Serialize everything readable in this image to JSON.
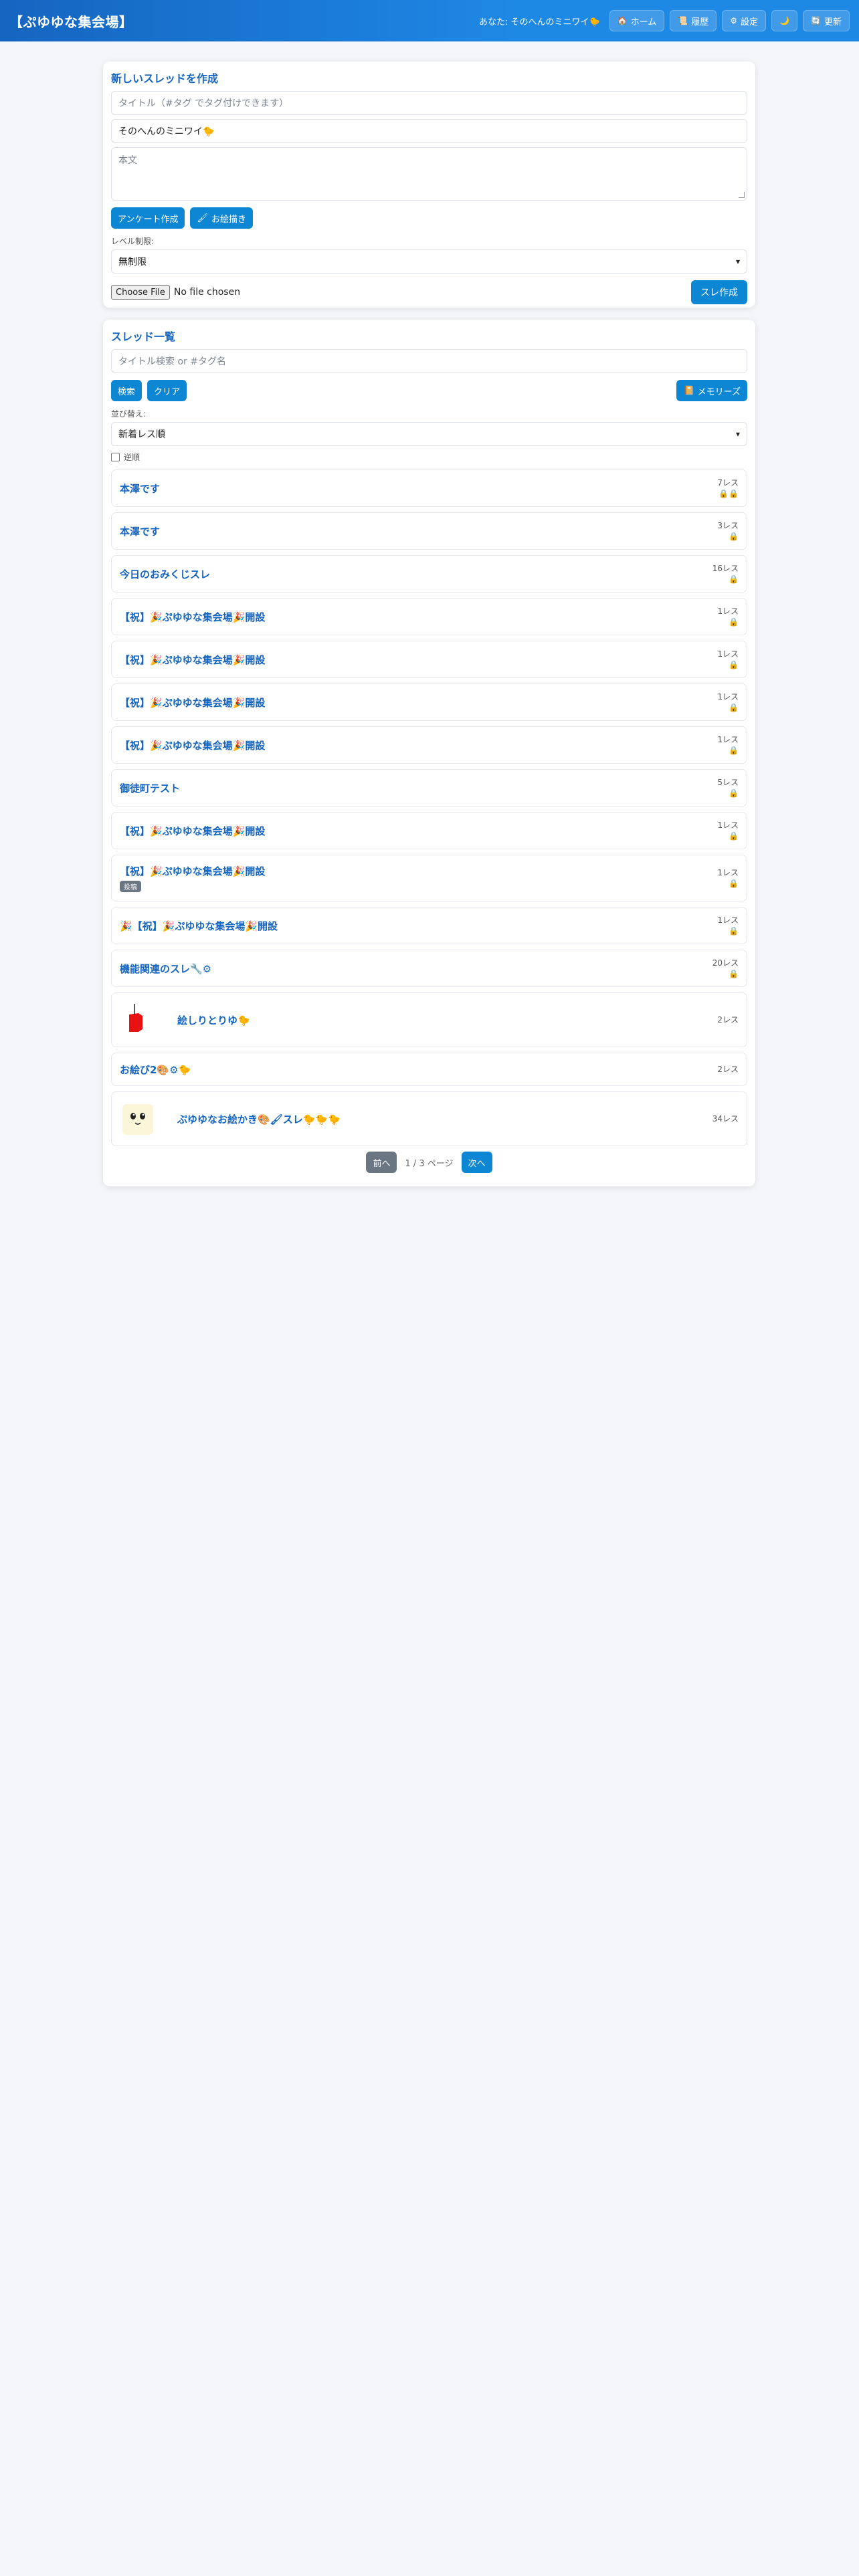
{
  "header": {
    "title": "【ぷゆゆな集会場】",
    "user_label": "あなた: そのへんのミニワイ🐤",
    "buttons": [
      {
        "icon": "🏠",
        "label": "ホーム"
      },
      {
        "icon": "📜",
        "label": "履歴"
      },
      {
        "icon": "⚙",
        "label": "設定"
      },
      {
        "icon": "🌙",
        "label": ""
      },
      {
        "icon": "🔄",
        "label": "更新"
      }
    ]
  },
  "create": {
    "title": "新しいスレッドを作成",
    "title_placeholder": "タイトル（#タグ でタグ付けできます）",
    "name_value": "そのへんのミニワイ🐤",
    "body_placeholder": "本文",
    "poll_button": "アンケート作成",
    "draw_button_icon": "🖌",
    "draw_button": "お絵描き",
    "level_label": "レベル制限:",
    "level_value": "無制限",
    "file_button": "Choose File",
    "file_status": "No file chosen",
    "submit": "スレ作成"
  },
  "list": {
    "title": "スレッド一覧",
    "search_placeholder": "タイトル検索 or #タグ名",
    "search_button": "検索",
    "clear_button": "クリア",
    "memories_icon": "📔",
    "memories_button": "メモリーズ",
    "sort_label": "並び替え:",
    "sort_value": "新着レス順",
    "reverse_label": "逆順",
    "threads": [
      {
        "title": "本澤です",
        "count": "7レス",
        "sub": "🔒🔒"
      },
      {
        "title": "本澤です",
        "count": "3レス",
        "sub": "🔒"
      },
      {
        "title": "今日のおみくじスレ",
        "count": "16レス",
        "sub": "🔒"
      },
      {
        "title": "【祝】🎉ぷゆゆな集会場🎉開設",
        "count": "1レス",
        "sub": "🔒"
      },
      {
        "title": "【祝】🎉ぷゆゆな集会場🎉開設",
        "count": "1レス",
        "sub": "🔒"
      },
      {
        "title": "【祝】🎉ぷゆゆな集会場🎉開設",
        "count": "1レス",
        "sub": "🔒"
      },
      {
        "title": "【祝】🎉ぷゆゆな集会場🎉開設",
        "count": "1レス",
        "sub": "🔒"
      },
      {
        "title": "御徒町テスト",
        "count": "5レス",
        "sub": "🔒"
      },
      {
        "title": "【祝】🎉ぷゆゆな集会場🎉開設",
        "count": "1レス",
        "sub": "🔒"
      },
      {
        "title": "【祝】🎉ぷゆゆな集会場🎉開設",
        "count": "1レス",
        "sub": "🔒",
        "badge": "投稿"
      },
      {
        "title": "🎉【祝】🎉ぷゆゆな集会場🎉開設",
        "count": "1レス",
        "sub": "🔒"
      },
      {
        "title": "機能関連のスレ🔧⚙",
        "count": "20レス",
        "sub": "🔒"
      },
      {
        "title": "絵しりとりゆ🐤",
        "count": "2レス",
        "sub": "",
        "thumb": "apple"
      },
      {
        "title": "お絵び2🎨⚙🐤",
        "count": "2レス",
        "sub": ""
      },
      {
        "title": "ぷゆゆなお絵かき🎨🖌スレ🐤🐤🐤",
        "count": "34レス",
        "sub": "",
        "thumb": "face"
      }
    ],
    "pager": {
      "prev": "前へ",
      "info": "1 / 3 ページ",
      "next": "次へ"
    }
  }
}
